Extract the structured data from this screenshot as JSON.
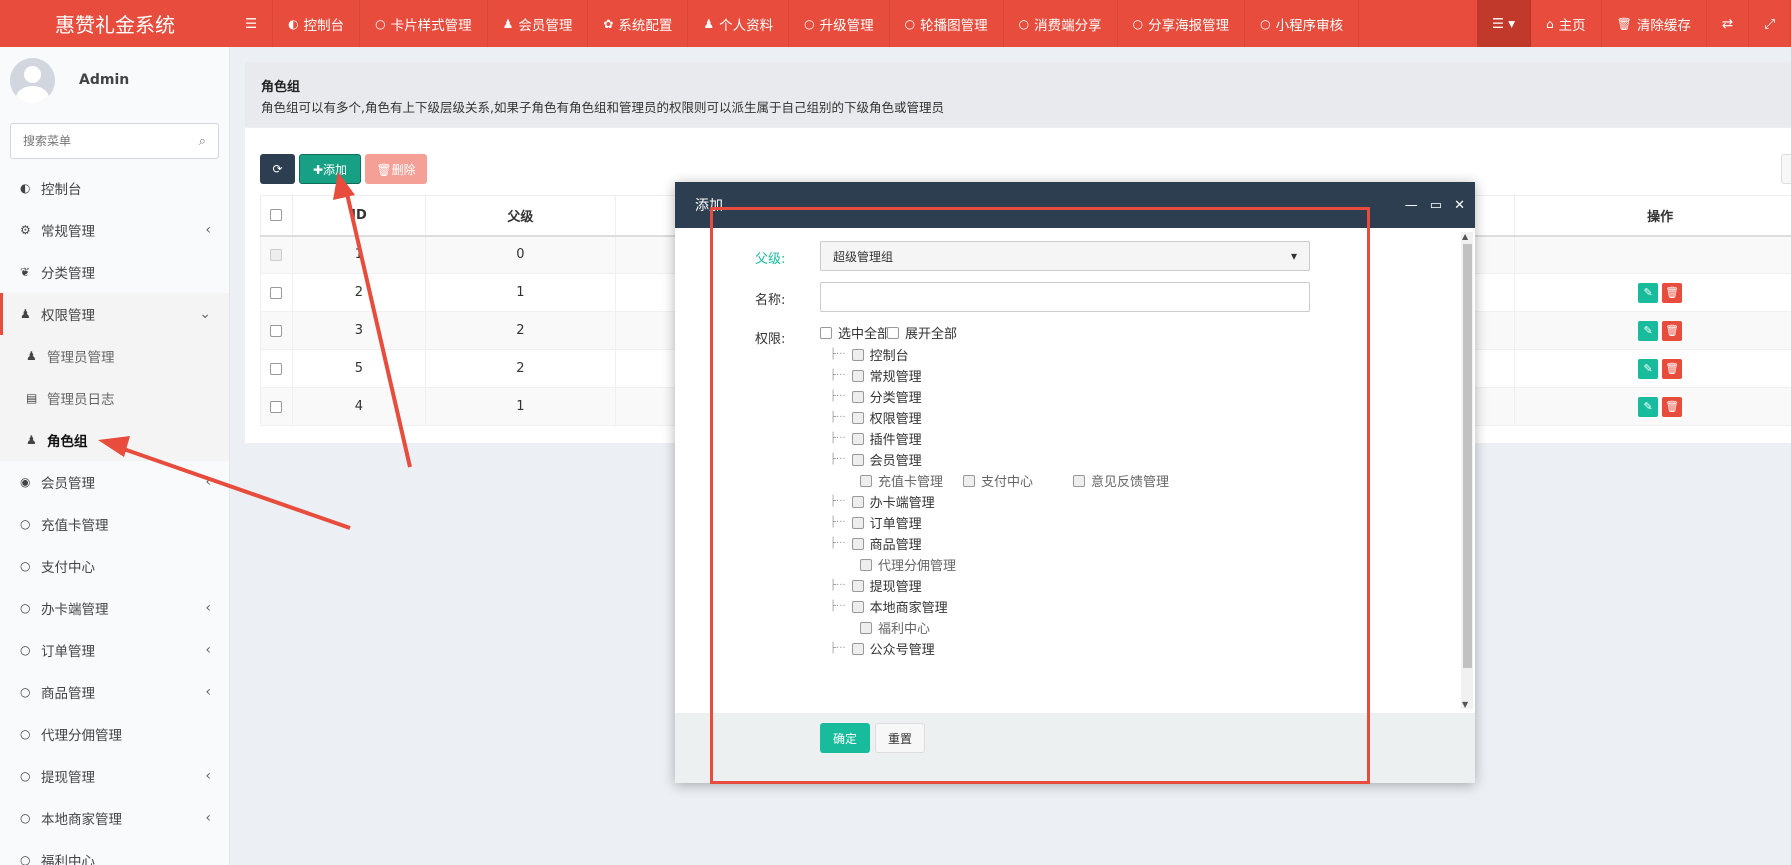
{
  "app": {
    "title": "惠赞礼金系统"
  },
  "topnav": [
    {
      "icon": "dashboard-icon",
      "glyph": "◐",
      "label": "控制台"
    },
    {
      "icon": "circle-icon",
      "glyph": "○",
      "label": "卡片样式管理"
    },
    {
      "icon": "user-icon",
      "glyph": "♟",
      "label": "会员管理"
    },
    {
      "icon": "gear-icon",
      "glyph": "✿",
      "label": "系统配置"
    },
    {
      "icon": "user-icon",
      "glyph": "♟",
      "label": "个人资料"
    },
    {
      "icon": "circle-icon",
      "glyph": "○",
      "label": "升级管理"
    },
    {
      "icon": "circle-icon",
      "glyph": "○",
      "label": "轮播图管理"
    },
    {
      "icon": "circle-icon",
      "glyph": "○",
      "label": "消费端分享"
    },
    {
      "icon": "circle-icon",
      "glyph": "○",
      "label": "分享海报管理"
    },
    {
      "icon": "circle-icon",
      "glyph": "○",
      "label": "小程序审核"
    }
  ],
  "topright": {
    "menu_glyph": "☰ ▾",
    "home": "主页",
    "clear_cache": "清除缓存",
    "lang_glyph": "⇄",
    "fullscreen_glyph": "⤢"
  },
  "sidebar": {
    "username": "Admin",
    "search_placeholder": "搜索菜单",
    "items": [
      {
        "glyph": "◐",
        "label": "控制台",
        "arrow": ""
      },
      {
        "glyph": "⚙",
        "label": "常规管理",
        "arrow": "‹"
      },
      {
        "glyph": "❦",
        "label": "分类管理",
        "arrow": ""
      },
      {
        "glyph": "♟",
        "label": "权限管理",
        "arrow": "⌄"
      },
      {
        "glyph": "♟",
        "label": "管理员管理",
        "arrow": ""
      },
      {
        "glyph": "▤",
        "label": "管理员日志",
        "arrow": ""
      },
      {
        "glyph": "♟",
        "label": "角色组",
        "arrow": ""
      },
      {
        "glyph": "◉",
        "label": "会员管理",
        "arrow": "‹"
      },
      {
        "glyph": "○",
        "label": "充值卡管理",
        "arrow": ""
      },
      {
        "glyph": "○",
        "label": "支付中心",
        "arrow": ""
      },
      {
        "glyph": "○",
        "label": "办卡端管理",
        "arrow": "‹"
      },
      {
        "glyph": "○",
        "label": "订单管理",
        "arrow": "‹"
      },
      {
        "glyph": "○",
        "label": "商品管理",
        "arrow": "‹"
      },
      {
        "glyph": "○",
        "label": "代理分佣管理",
        "arrow": ""
      },
      {
        "glyph": "○",
        "label": "提现管理",
        "arrow": "‹"
      },
      {
        "glyph": "○",
        "label": "本地商家管理",
        "arrow": "‹"
      },
      {
        "glyph": "○",
        "label": "福利中心",
        "arrow": ""
      }
    ]
  },
  "content": {
    "title": "角色组",
    "description": "角色组可以有多个,角色有上下级层级关系,如果子角色有角色组和管理员的权限则可以派生属于自己组别的下级角色或管理员",
    "toolbar": {
      "refresh_glyph": "⟳",
      "add_label": "✚添加",
      "delete_label": "🗑删除",
      "columns_glyph": "▤"
    },
    "table": {
      "headers": [
        "ID",
        "父级",
        "操作"
      ],
      "rows": [
        {
          "id": "1",
          "parent": "0"
        },
        {
          "id": "2",
          "parent": "1"
        },
        {
          "id": "3",
          "parent": "2"
        },
        {
          "id": "5",
          "parent": "2"
        },
        {
          "id": "4",
          "parent": "1"
        }
      ],
      "edit_glyph": "✎",
      "delete_glyph": "🗑"
    }
  },
  "modal": {
    "title": "添加",
    "controls": {
      "min": "—",
      "max": "▭",
      "close": "✕"
    },
    "parent_label": "父级:",
    "parent_value": "超级管理组",
    "name_label": "名称:",
    "name_value": "",
    "perm_label": "权限:",
    "select_all": "选中全部",
    "expand_all": "展开全部",
    "tree": [
      {
        "label": "控制台",
        "leaf": false
      },
      {
        "label": "常规管理",
        "leaf": false
      },
      {
        "label": "分类管理",
        "leaf": false
      },
      {
        "label": "权限管理",
        "leaf": false
      },
      {
        "label": "插件管理",
        "leaf": false
      },
      {
        "label": "会员管理",
        "leaf": false
      },
      {
        "label": "充值卡管理",
        "leaf": true
      },
      {
        "label": "支付中心",
        "leaf": true
      },
      {
        "label": "意见反馈管理",
        "leaf": true
      },
      {
        "label": "办卡端管理",
        "leaf": false
      },
      {
        "label": "订单管理",
        "leaf": false
      },
      {
        "label": "商品管理",
        "leaf": false
      },
      {
        "label": "代理分佣管理",
        "leaf": true
      },
      {
        "label": "提现管理",
        "leaf": false
      },
      {
        "label": "本地商家管理",
        "leaf": false
      },
      {
        "label": "福利中心",
        "leaf": true
      },
      {
        "label": "公众号管理",
        "leaf": false
      }
    ],
    "ok_label": "确定",
    "reset_label": "重置"
  },
  "colors": {
    "brand": "#e74c3c",
    "dark": "#2c3e50",
    "success": "#18bc9c"
  }
}
